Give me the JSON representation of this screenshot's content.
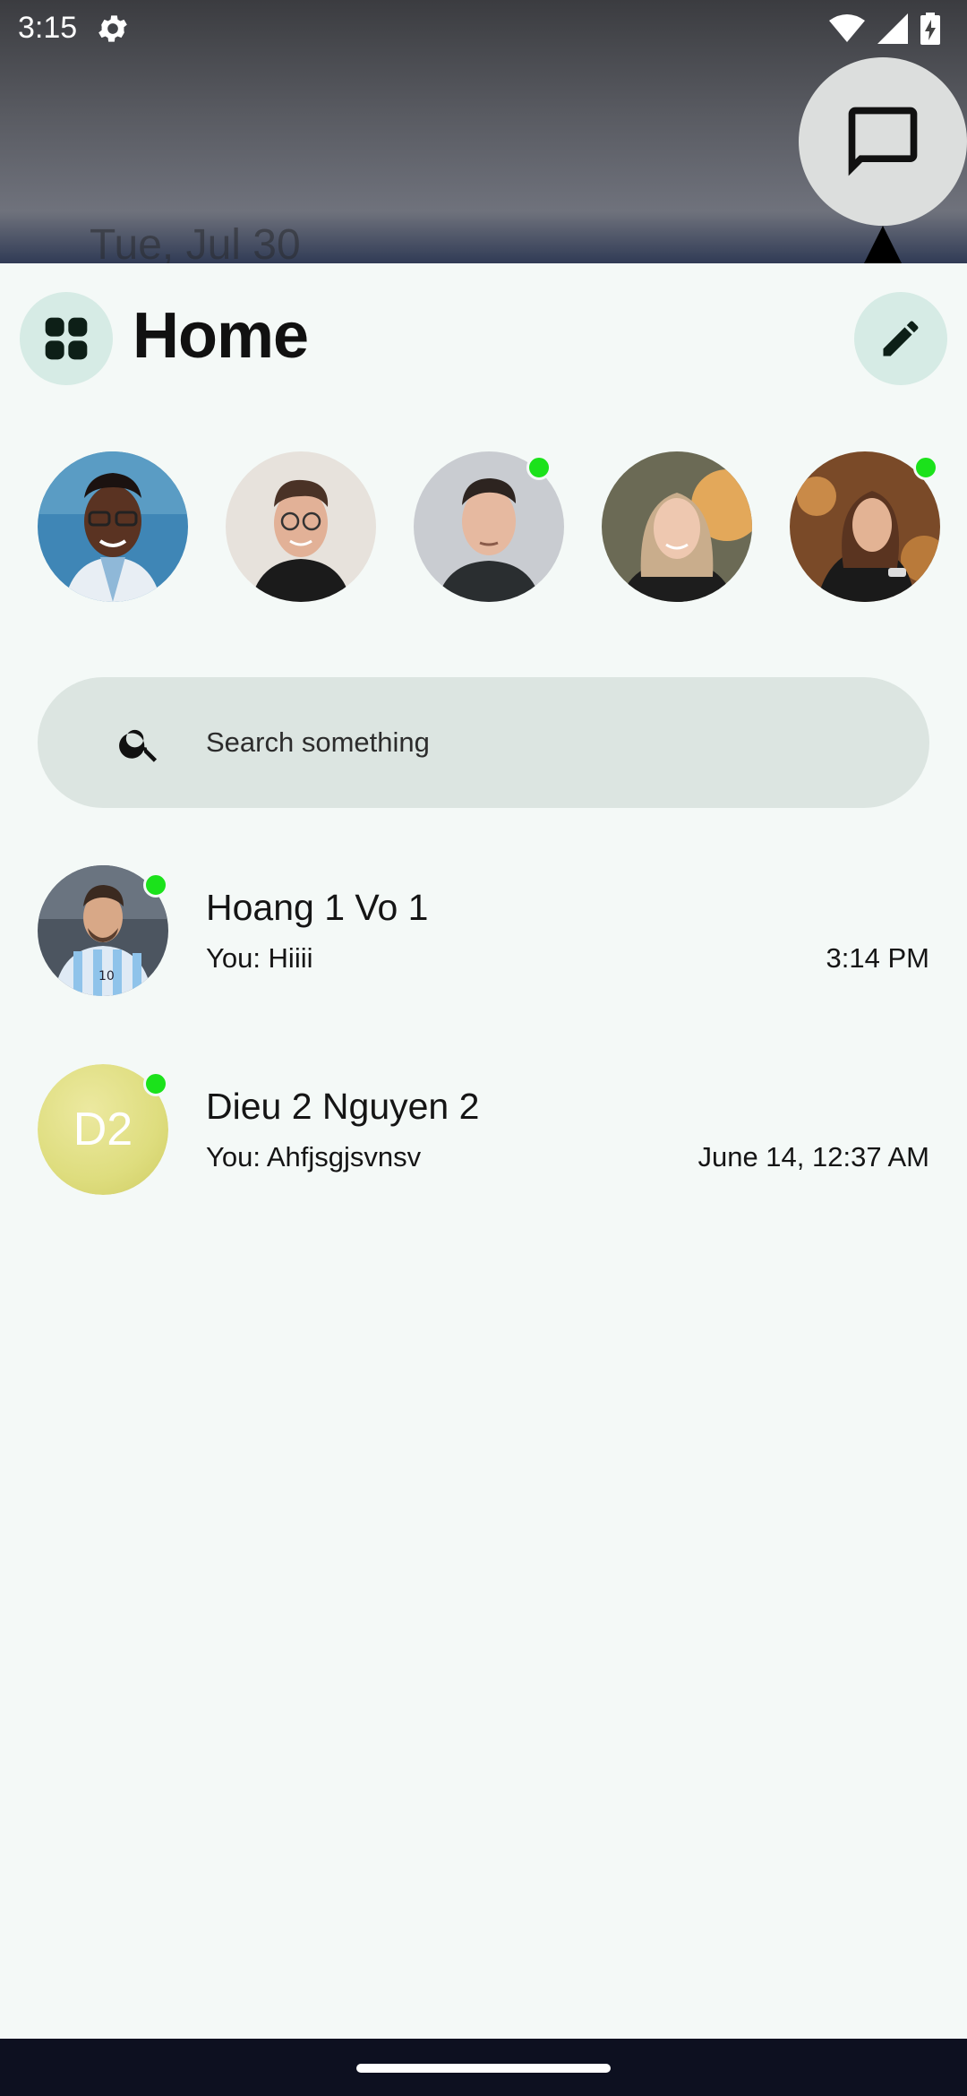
{
  "status_bar": {
    "time": "3:15"
  },
  "background": {
    "date_text": "Tue, Jul 30"
  },
  "header": {
    "title": "Home",
    "menu_icon": "grid-icon",
    "edit_icon": "pencil-icon"
  },
  "stories": [
    {
      "name": "story-1",
      "online": false
    },
    {
      "name": "story-2",
      "online": false
    },
    {
      "name": "story-3",
      "online": true
    },
    {
      "name": "story-4",
      "online": false
    },
    {
      "name": "story-5",
      "online": true
    }
  ],
  "search": {
    "placeholder": "Search something"
  },
  "chats": [
    {
      "name": "Hoang 1 Vo 1",
      "preview": "You: Hiiii",
      "time": "3:14 PM",
      "online": true
    },
    {
      "name": "Dieu 2 Nguyen 2",
      "preview": "You: Ahfjsgjsvnsv",
      "time": "June 14, 12:37 AM",
      "initials": "D2",
      "online": true
    }
  ],
  "colors": {
    "panel_bg": "#f4f9f7",
    "accent_circle": "#d6ebe5",
    "search_bg": "#dce5e1",
    "online": "#1be21b"
  }
}
